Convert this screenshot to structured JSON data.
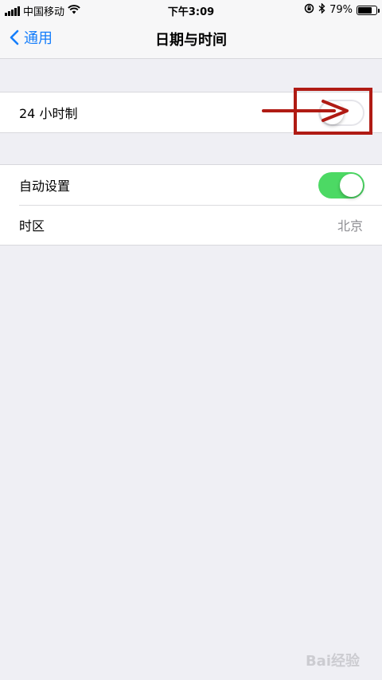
{
  "status_bar": {
    "carrier": "中国移动",
    "time": "下午3:09",
    "battery_percent": "79%",
    "battery_level": 0.79,
    "icons": [
      "signal-icon",
      "wifi-icon",
      "orientation-lock-icon",
      "bluetooth-icon",
      "battery-icon"
    ]
  },
  "nav": {
    "back_label": "通用",
    "title": "日期与时间"
  },
  "settings": {
    "hour24": {
      "label": "24 小时制",
      "enabled": false
    },
    "auto_set": {
      "label": "自动设置",
      "enabled": true
    },
    "timezone": {
      "label": "时区",
      "value": "北京"
    }
  },
  "colors": {
    "accent_blue": "#157efb",
    "toggle_on": "#4cd964",
    "annotation_red": "#b01b14",
    "background": "#efeff4"
  },
  "watermark": {
    "text": "Bai经验"
  }
}
